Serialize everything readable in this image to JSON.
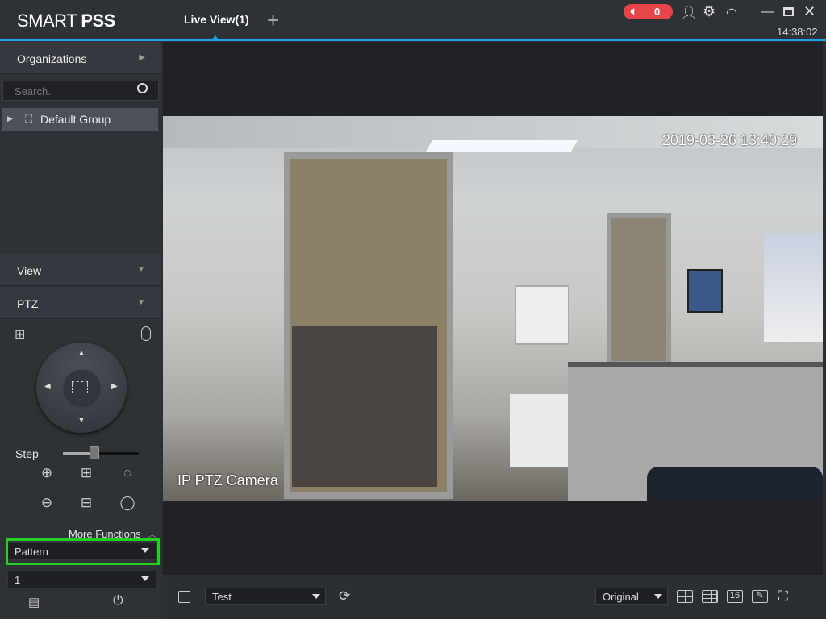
{
  "app": {
    "logo_light": "SMART ",
    "logo_bold": "PSS",
    "tab": "Live View(1)",
    "add_tab": "+",
    "alarm_count": "0",
    "clock": "14:38:02"
  },
  "sidebar": {
    "organizations": "Organizations",
    "search_placeholder": "Search..",
    "tree_item": "Default Group",
    "view": "View",
    "ptz": "PTZ",
    "step": "Step",
    "step_level": 0.4,
    "more_functions": "More Functions",
    "function_select": "Pattern",
    "number_select": "1"
  },
  "video": {
    "osd_time": "2019-03-26 13:40:29",
    "osd_name": "IP PTZ Camera"
  },
  "bottom": {
    "view_select": "Test",
    "stream_select": "Original",
    "split_16": "16"
  },
  "colors": {
    "accent": "#1fa3e6",
    "alarm": "#e8454a",
    "highlight": "#22d222"
  }
}
